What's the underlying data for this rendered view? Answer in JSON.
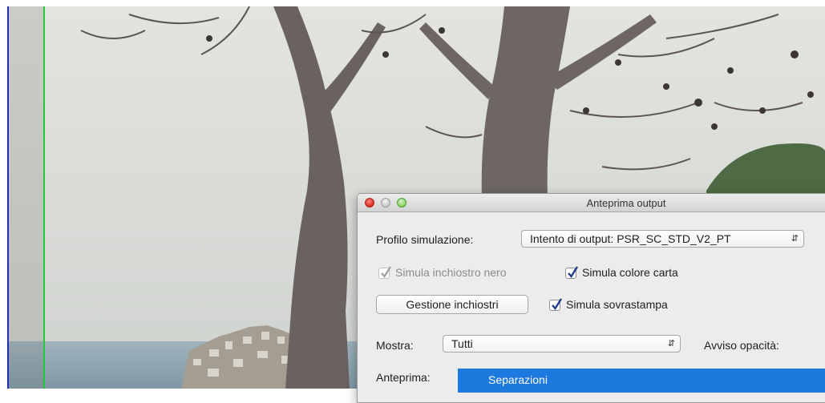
{
  "dialog": {
    "title": "Anteprima output",
    "simulation_profile": {
      "label": "Profilo simulazione:",
      "selected": "Intento di output: PSR_SC_STD_V2_PT"
    },
    "checkboxes": {
      "simulate_black_ink": {
        "label": "Simula inchiostro nero",
        "checked": true,
        "enabled": false
      },
      "simulate_paper_color": {
        "label": "Simula colore carta",
        "checked": true,
        "enabled": true
      },
      "simulate_overprint": {
        "label": "Simula sovrastampa",
        "checked": true,
        "enabled": true
      }
    },
    "ink_manager_button": "Gestione inchiostri",
    "show": {
      "label": "Mostra:",
      "selected": "Tutti"
    },
    "opacity_warning_label": "Avviso opacità:",
    "preview": {
      "label": "Anteprima:",
      "selected": "Separazioni"
    }
  },
  "colors": {
    "selection_blue": "#1d79dd",
    "bleed_guide": "#22c93c",
    "page_edge": "#1d2bd6"
  }
}
